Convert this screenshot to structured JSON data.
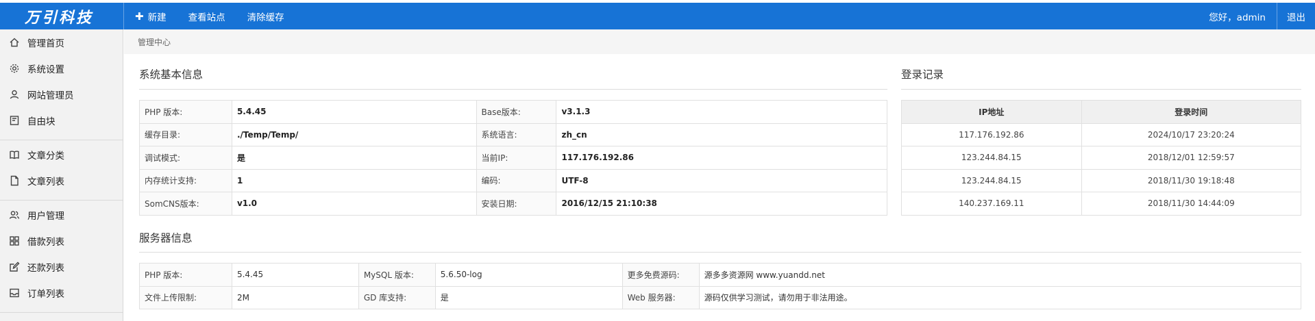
{
  "logo": {
    "text": "万引科技"
  },
  "topnav": [
    {
      "icon": "plus-icon",
      "label": "新建"
    },
    {
      "label": "查看站点"
    },
    {
      "label": "清除缓存"
    }
  ],
  "user": {
    "greeting": "您好，admin",
    "logout": "退出"
  },
  "sidebar": {
    "items": [
      {
        "icon": "home-icon",
        "label": "管理首页"
      },
      {
        "icon": "gear-icon",
        "label": "系统设置"
      },
      {
        "icon": "user-icon",
        "label": "网站管理员"
      },
      {
        "icon": "block-icon",
        "label": "自由块"
      },
      {
        "icon": "book-icon",
        "label": "文章分类"
      },
      {
        "icon": "file-icon",
        "label": "文章列表"
      },
      {
        "icon": "users-icon",
        "label": "用户管理"
      },
      {
        "icon": "grid-icon",
        "label": "借款列表"
      },
      {
        "icon": "edit-icon",
        "label": "还款列表"
      },
      {
        "icon": "inbox-icon",
        "label": "订单列表"
      }
    ]
  },
  "breadcrumb": "管理中心",
  "system_info": {
    "title": "系统基本信息",
    "rows": [
      [
        "PHP 版本:",
        "5.4.45",
        "Base版本:",
        "v3.1.3"
      ],
      [
        "缓存目录:",
        "./Temp/Temp/",
        "系统语言:",
        "zh_cn"
      ],
      [
        "调试模式:",
        "是",
        "当前IP:",
        "117.176.192.86"
      ],
      [
        "内存统计支持:",
        "1",
        "编码:",
        "UTF-8"
      ],
      [
        "SomCNS版本:",
        "v1.0",
        "安装日期:",
        "2016/12/15 21:10:38"
      ]
    ]
  },
  "login_records": {
    "title": "登录记录",
    "headers": [
      "IP地址",
      "登录时间"
    ],
    "rows": [
      [
        "117.176.192.86",
        "2024/10/17 23:20:24"
      ],
      [
        "123.244.84.15",
        "2018/12/01 12:59:57"
      ],
      [
        "123.244.84.15",
        "2018/11/30 19:18:48"
      ],
      [
        "140.237.169.11",
        "2018/11/30 14:44:09"
      ]
    ]
  },
  "server_info": {
    "title": "服务器信息",
    "rows": [
      [
        "PHP 版本:",
        "5.4.45",
        "MySQL 版本:",
        "5.6.50-log",
        "更多免费源码:",
        "源多多资源网 www.yuandd.net"
      ],
      [
        "文件上传限制:",
        "2M",
        "GD 库支持:",
        "是",
        "Web 服务器:",
        "源码仅供学习测试，请勿用于非法用途。"
      ]
    ]
  },
  "colors": {
    "topbar": "#1773d6",
    "sidebar": "#f2f2f2"
  }
}
